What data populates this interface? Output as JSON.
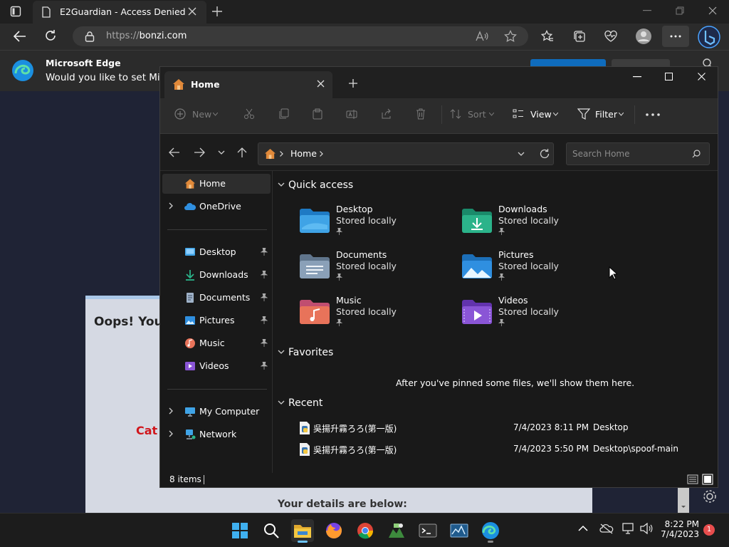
{
  "browser": {
    "tab_title": "E2Guardian - Access Denied",
    "url_protocol": "https://",
    "url_host": "bonzi.com",
    "notification": {
      "title": "Microsoft Edge",
      "text": "Would you like to set Micr"
    }
  },
  "webpage": {
    "oops_text": "Oops! You",
    "red_text": "Cat",
    "details_text": "Your details are below:"
  },
  "explorer": {
    "tab_label": "Home",
    "toolbar": {
      "new_label": "New",
      "sort_label": "Sort",
      "view_label": "View",
      "filter_label": "Filter"
    },
    "breadcrumb": "Home",
    "search_placeholder": "Search Home",
    "sidebar": {
      "home": "Home",
      "onedrive": "OneDrive",
      "desktop": "Desktop",
      "downloads": "Downloads",
      "documents": "Documents",
      "pictures": "Pictures",
      "music": "Music",
      "videos": "Videos",
      "my_computer": "My Computer",
      "network": "Network"
    },
    "sections": {
      "quick_access": "Quick access",
      "favorites": "Favorites",
      "recent": "Recent"
    },
    "quick_access": [
      {
        "name": "Desktop",
        "status": "Stored locally"
      },
      {
        "name": "Downloads",
        "status": "Stored locally"
      },
      {
        "name": "Documents",
        "status": "Stored locally"
      },
      {
        "name": "Pictures",
        "status": "Stored locally"
      },
      {
        "name": "Music",
        "status": "Stored locally"
      },
      {
        "name": "Videos",
        "status": "Stored locally"
      }
    ],
    "favorites_empty": "After you've pinned some files, we'll show them here.",
    "recent": [
      {
        "name": "吳揚升霧ろろ(第一版)",
        "date": "7/4/2023 8:11 PM",
        "location": "Desktop"
      },
      {
        "name": "吳揚升霧ろろ(第一版)",
        "date": "7/4/2023 5:50 PM",
        "location": "Desktop\\spoof-main"
      }
    ],
    "status_items": "8 items"
  },
  "taskbar": {
    "time": "8:22 PM",
    "date": "7/4/2023",
    "notification_count": "1"
  },
  "colors": {
    "accent": "#0078d4",
    "folder_desktop": "#3fa3e6",
    "folder_downloads": "#2bb38a",
    "folder_documents": "#8aa0b8",
    "folder_pictures": "#2f8fe0",
    "folder_music": "#e8735a",
    "folder_videos": "#8a55d6"
  }
}
